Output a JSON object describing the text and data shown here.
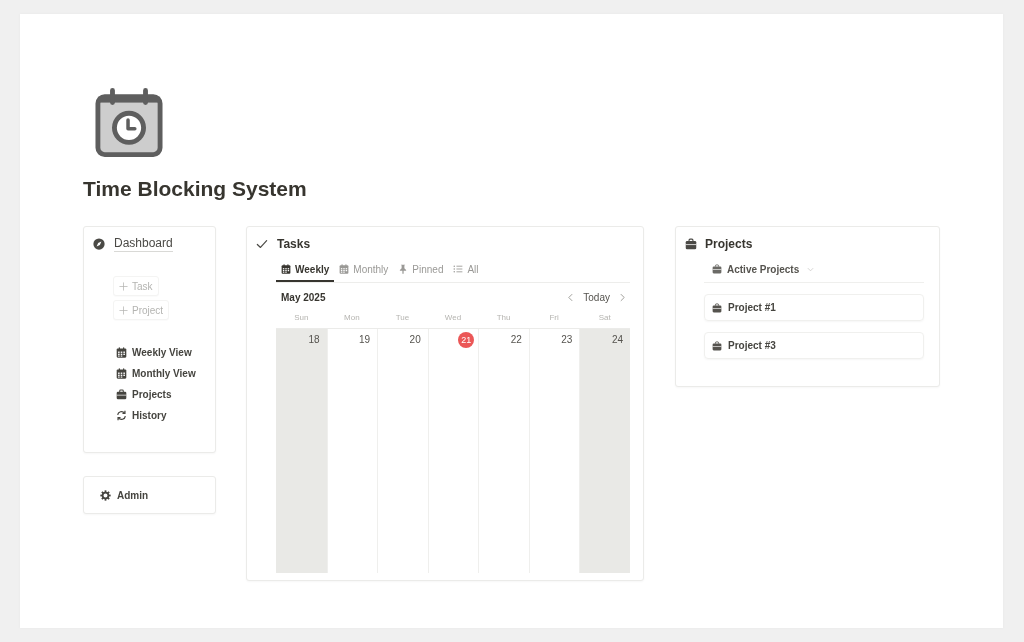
{
  "page": {
    "title": "Time Blocking System"
  },
  "dashboard": {
    "title": "Dashboard",
    "actions": [
      "Task",
      "Project"
    ],
    "links": [
      "Weekly View",
      "Monthly View",
      "Projects",
      "History"
    ]
  },
  "admin": {
    "label": "Admin"
  },
  "tasks": {
    "title": "Tasks",
    "tabs": [
      {
        "label": "Weekly",
        "selected": true
      },
      {
        "label": "Monthly",
        "selected": false
      },
      {
        "label": "Pinned",
        "selected": false
      },
      {
        "label": "All",
        "selected": false
      }
    ],
    "calendar": {
      "month": "May 2025",
      "today_button": "Today",
      "weekdays": [
        "Sun",
        "Mon",
        "Tue",
        "Wed",
        "Thu",
        "Fri",
        "Sat"
      ],
      "days": [
        {
          "label": "18",
          "weekend": true,
          "today": false
        },
        {
          "label": "19",
          "weekend": false,
          "today": false
        },
        {
          "label": "20",
          "weekend": false,
          "today": false
        },
        {
          "label": "21",
          "weekend": false,
          "today": true
        },
        {
          "label": "22",
          "weekend": false,
          "today": false
        },
        {
          "label": "23",
          "weekend": false,
          "today": false
        },
        {
          "label": "24",
          "weekend": true,
          "today": false
        }
      ]
    }
  },
  "projects": {
    "title": "Projects",
    "view": "Active Projects",
    "items": [
      "Project #1",
      "Project #3"
    ]
  }
}
